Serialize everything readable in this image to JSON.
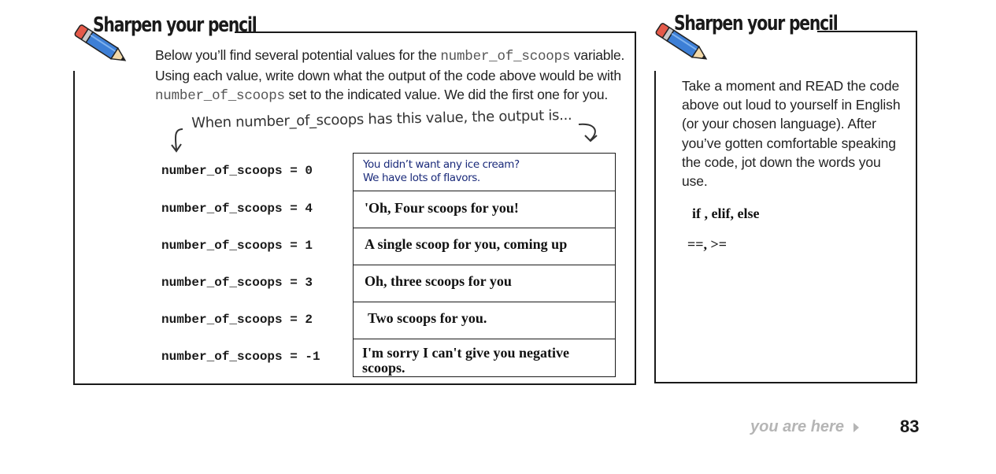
{
  "left_panel": {
    "heading": "Sharpen your pencil",
    "intro": {
      "part1": "Below you’ll find several potential values for the ",
      "code1": "number_of_scoops",
      "part2": " variable. Using each value, write down what the output of the code above would be with ",
      "code2": "number_of_scoops",
      "part3": " set to the indicated value. We did the first one for you."
    },
    "handwritten_note": "When number_of_scoops has this value, the output is...",
    "rows": [
      {
        "label": "number_of_scoops = 0",
        "answer_line1": "You didn’t want any ice cream?",
        "answer_line2": "We have lots of flavors."
      },
      {
        "label": "number_of_scoops = 4",
        "answer": "'Oh, Four scoops for you!"
      },
      {
        "label": "number_of_scoops = 1",
        "answer": "A single scoop for you, coming up"
      },
      {
        "label": "number_of_scoops = 3",
        "answer": "Oh, three scoops for you"
      },
      {
        "label": "number_of_scoops = 2",
        "answer": "Two scoops for you."
      },
      {
        "label": "number_of_scoops = -1",
        "answer": "I'm sorry I can't give you negative scoops."
      }
    ]
  },
  "right_panel": {
    "heading": "Sharpen your pencil",
    "instructions": "Take a moment and READ the code above out loud to yourself in English (or your chosen language). After you’ve gotten comfortable speaking the code, jot down the words you use.",
    "answers": [
      "if , elif, else",
      "==, >="
    ]
  },
  "footer": {
    "you_are_here": "you are here",
    "page_number": "83"
  }
}
